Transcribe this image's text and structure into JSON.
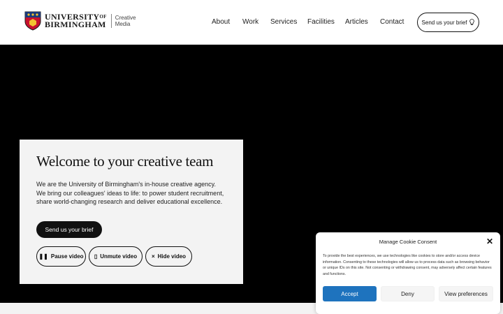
{
  "header": {
    "logo": {
      "line1": "UNIVERSITY",
      "line1_of": "OF",
      "line2": "BIRMINGHAM",
      "sub_line1": "Creative",
      "sub_line2": "Media"
    },
    "nav": [
      "About",
      "Work",
      "Services",
      "Facilities",
      "Articles",
      "Contact"
    ],
    "brief_button": "Send us your brief",
    "brief_icon": "lightbulb-icon"
  },
  "hero": {
    "title": "Welcome to your creative team",
    "description": "We are the University of Birmingham's in-house creative agency. We bring our colleagues' ideas to life: to power student recruitment, share world-changing research and deliver educational excellence.",
    "cta": "Send us your brief",
    "controls": {
      "pause": "Pause video",
      "unmute": "Unmute video",
      "hide": "Hide video"
    }
  },
  "cookie": {
    "title": "Manage Cookie Consent",
    "body": "To provide the best experiences, we use technologies like cookies to store and/or access device information. Consenting to these technologies will allow us to process data such as browsing behavior or unique IDs on this site. Not consenting or withdrawing consent, may adversely affect certain features and functions.",
    "accept": "Accept",
    "deny": "Deny",
    "preferences": "View preferences"
  },
  "colors": {
    "accent": "#1e73be",
    "dark": "#111111",
    "card_bg": "#f3f3f3"
  }
}
